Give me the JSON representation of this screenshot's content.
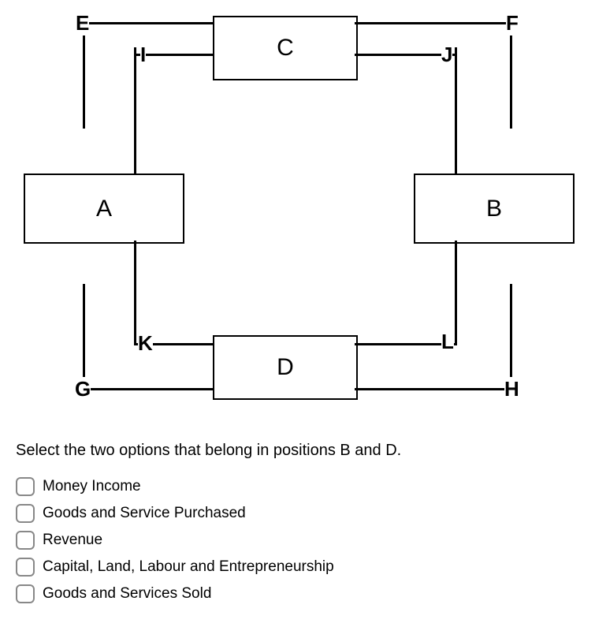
{
  "diagram": {
    "boxes": {
      "A": "A",
      "B": "B",
      "C": "C",
      "D": "D"
    },
    "labels": {
      "E": "E",
      "F": "F",
      "G": "G",
      "H": "H",
      "I": "I",
      "J": "J",
      "K": "K",
      "L": "L"
    }
  },
  "question": {
    "prompt": "Select the two options that belong in positions B and D.",
    "options": [
      "Money Income",
      "Goods and Service Purchased",
      "Revenue",
      "Capital, Land, Labour and Entrepreneurship",
      "Goods and Services Sold"
    ]
  }
}
